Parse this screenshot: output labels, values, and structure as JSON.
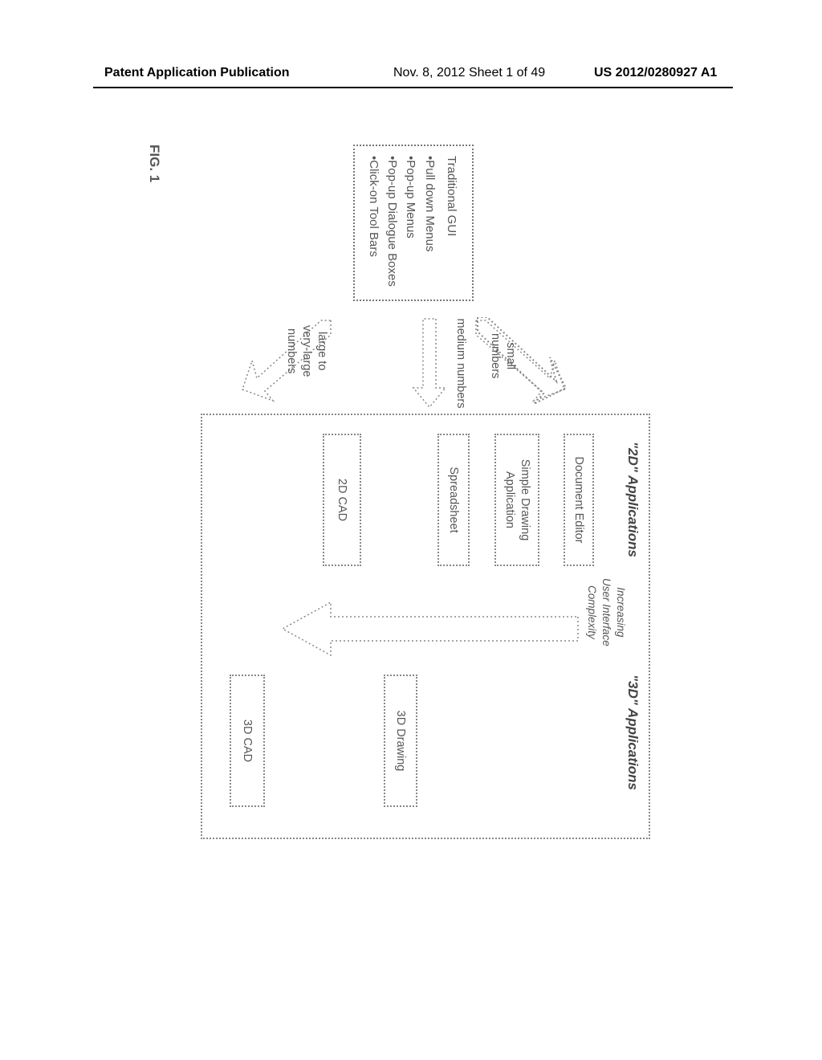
{
  "header": {
    "left": "Patent Application Publication",
    "middle": "Nov. 8, 2012  Sheet 1 of 49",
    "right": "US 2012/0280927 A1"
  },
  "gui_box": {
    "title": "Traditional GUI",
    "items": [
      "•Pull down Menus",
      "•Pop-up Menus",
      "•Pop-up Dialogue Boxes",
      "•Click-on Tool Bars"
    ]
  },
  "arrows": {
    "small": "small\nnumbers",
    "medium": "medium numbers",
    "large": "large to\nvery-large\nnumbers"
  },
  "columns": {
    "left": "\"2D\" Applications",
    "right": "\"3D\" Applications"
  },
  "complexity_label": "Increasing\nUser Interface\nComplexity",
  "boxes": {
    "doc": "Document Editor",
    "drawing": "Simple Drawing\nApplication",
    "spread": "Spreadsheet",
    "cad2d": "2D CAD",
    "draw3d": "3D Drawing",
    "cad3d": "3D CAD"
  },
  "figure_label": "FIG. 1"
}
